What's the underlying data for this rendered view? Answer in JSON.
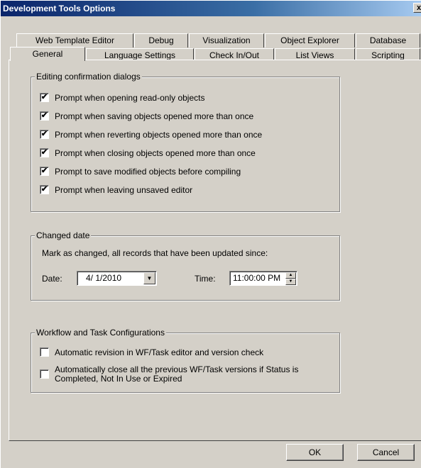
{
  "window": {
    "title": "Development Tools Options",
    "close_glyph": "x"
  },
  "tabs_row1": [
    "Web Template Editor",
    "Debug",
    "Visualization",
    "Object Explorer",
    "Database"
  ],
  "tabs_row2": [
    "General",
    "Language Settings",
    "Check In/Out",
    "List Views",
    "Scripting"
  ],
  "active_tab": "General",
  "editing_group": {
    "legend": "Editing confirmation dialogs",
    "items": [
      {
        "label": "Prompt when opening read-only objects",
        "checked": true
      },
      {
        "label": "Prompt when saving objects opened more than once",
        "checked": true
      },
      {
        "label": "Prompt when reverting objects opened more than once",
        "checked": true
      },
      {
        "label": "Prompt when closing objects opened more than once",
        "checked": true
      },
      {
        "label": "Prompt to save modified objects before compiling",
        "checked": true
      },
      {
        "label": "Prompt when leaving unsaved editor",
        "checked": true
      }
    ]
  },
  "changed_group": {
    "legend": "Changed date",
    "description": "Mark as changed, all records that have been updated since:",
    "date_label": "Date:",
    "date_value": "4/ 1/2010",
    "time_label": "Time:",
    "time_value": "11:00:00 PM"
  },
  "workflow_group": {
    "legend": "Workflow and Task Configurations",
    "items": [
      {
        "label": "Automatic revision in WF/Task editor and version check",
        "checked": false
      },
      {
        "label": "Automatically close all the previous WF/Task versions if Status is",
        "label2": "Completed, Not In Use or Expired",
        "checked": false
      }
    ]
  },
  "buttons": {
    "ok": "OK",
    "cancel": "Cancel"
  },
  "check_glyph": "✔"
}
